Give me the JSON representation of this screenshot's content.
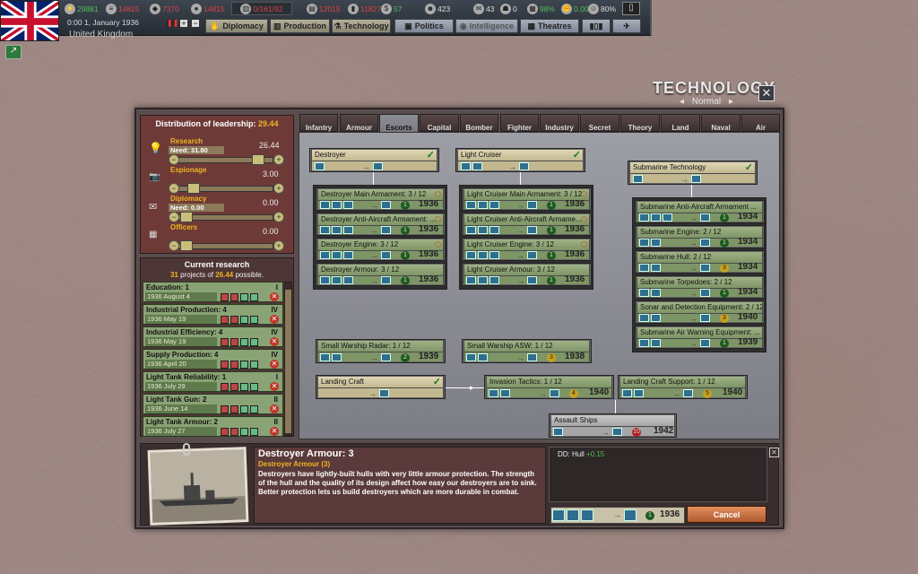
{
  "topbar": {
    "resources": [
      "29881",
      "14815",
      "7370",
      "14815",
      "0/161/92",
      "12015",
      "11827",
      "57",
      "423",
      "43",
      "0",
      "98%",
      "0.00",
      "80%"
    ],
    "date": "0:00 1, January 1936",
    "country": "United Kingdom",
    "tabs": [
      "Diplomacy",
      "Production",
      "Technology",
      "Politics",
      "Intelligence",
      "Theatres"
    ]
  },
  "window": {
    "title": "TECHNOLOGY",
    "mode": "Normal"
  },
  "tech_tabs": [
    "Infantry",
    "Armour",
    "Escorts",
    "Capital",
    "Bomber",
    "Fighter",
    "Industry",
    "Secret",
    "Theory",
    "Land",
    "Naval",
    "Air"
  ],
  "leadership": {
    "title": "Distribution of leadership:",
    "total": "29.44",
    "research": {
      "label": "Research",
      "need": "Need: 31.80",
      "value": "26.44"
    },
    "espionage": {
      "label": "Espionage",
      "value": "3.00"
    },
    "diplomacy": {
      "label": "Diplomacy",
      "need": "Need: 0.00",
      "value": "0.00"
    },
    "officers": {
      "label": "Officers",
      "value": "0.00"
    }
  },
  "current": {
    "title": "Current research",
    "count": "31",
    "count_text1": "projects of",
    "possible": "26.44",
    "count_text2": "possible.",
    "items": [
      {
        "name": "Education: 1",
        "date": "1936 August 4",
        "roman": "I"
      },
      {
        "name": "Industrial Production: 4",
        "date": "1936 May 19",
        "roman": "IV"
      },
      {
        "name": "Industrial Efficiency: 4",
        "date": "1936 May 19",
        "roman": "IV"
      },
      {
        "name": "Supply Production: 4",
        "date": "1936 April 20",
        "roman": "IV"
      },
      {
        "name": "Light Tank Reliability: 1",
        "date": "1936 July 29",
        "roman": "I"
      },
      {
        "name": "Light Tank Gun: 2",
        "date": "1936 June 14",
        "roman": "II"
      },
      {
        "name": "Light Tank Armour: 2",
        "date": "1936 July 27",
        "roman": "II"
      }
    ]
  },
  "tree": {
    "destroyer": "Destroyer",
    "light_cruiser": "Light Cruiser",
    "submarine": "Submarine Technology",
    "d_main": "Destroyer Main Armament: 3 / 12",
    "d_aa": "Destroyer Anti-Aircraft Armament: ...",
    "d_eng": "Destroyer Engine: 3 / 12",
    "d_arm": "Destroyer Armour: 3 / 12",
    "lc_main": "Light Cruiser Main Armament: 3 / 12",
    "lc_aa": "Light Cruiser Anti-Aircraft Armame...",
    "lc_eng": "Light Cruiser Engine: 3 / 12",
    "lc_arm": "Light Cruiser Armour: 3 / 12",
    "s_aa": "Submarine Anti-Aircraft Armament ...",
    "s_eng": "Submarine Engine: 2 / 12",
    "s_hull": "Submarine Hull: 2 / 12",
    "s_torp": "Submarine Torpedoes: 2 / 12",
    "s_sonar": "Sonar and Detection Equipment: 2 / 12",
    "s_air": "Submarine Air Warning Equipment: ...",
    "radar": "Small Warship Radar: 1 / 12",
    "asw": "Small Warship ASW: 1 / 12",
    "landing": "Landing Craft",
    "invasion": "Invasion Tactics: 1 / 12",
    "lcs": "Landing Craft Support: 1 / 12",
    "assault": "Assault Ships",
    "y1936": "1936",
    "y1934": "1934",
    "y1940": "1940",
    "y1939": "1939",
    "y1938": "1938",
    "y1942": "1942",
    "l1": "1",
    "l2": "2",
    "l3": "3",
    "l4": "4",
    "l5": "5",
    "l10": "10"
  },
  "detail": {
    "title": "Destroyer Armour: 3",
    "subtitle": "Destroyer Armour (3)",
    "text": "Destroyers have lightly-built hulls with very little armour protection. The strength of the hull and the quality of its design affect how easy our destroyers are to sink. Better protection lets us build destroyers which are more durable in combat.",
    "effect_label": "DD: Hull",
    "effect_value": "+0.15",
    "year": "1936",
    "level": "1",
    "cancel": "Cancel"
  }
}
